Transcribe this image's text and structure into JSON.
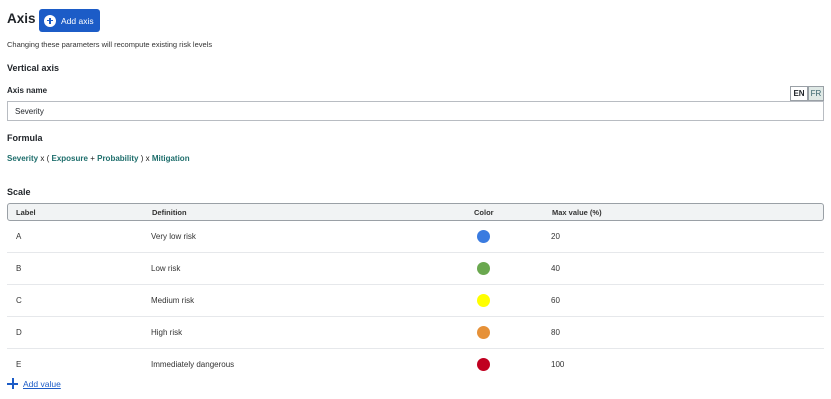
{
  "header": {
    "title": "Axis",
    "add_axis_label": "Add axis",
    "subtitle": "Changing these parameters will recompute existing risk levels"
  },
  "vertical_axis": {
    "title": "Vertical axis",
    "axis_name_label": "Axis name",
    "axis_name_value": "Severity",
    "languages": [
      "EN",
      "FR"
    ],
    "selected_language": "EN"
  },
  "formula": {
    "title": "Formula",
    "parts": [
      {
        "text": "Severity",
        "kind": "term"
      },
      {
        "text": "x (",
        "kind": "op"
      },
      {
        "text": "Exposure",
        "kind": "term"
      },
      {
        "text": "+",
        "kind": "op"
      },
      {
        "text": "Probability",
        "kind": "term"
      },
      {
        "text": ") x",
        "kind": "op"
      },
      {
        "text": "Mitigation",
        "kind": "term"
      }
    ]
  },
  "scale": {
    "title": "Scale",
    "columns": [
      "Label",
      "Definition",
      "Color",
      "Max value (%)"
    ],
    "rows": [
      {
        "label": "A",
        "definition": "Very low risk",
        "color": "#3a7be0",
        "max_value": "20"
      },
      {
        "label": "B",
        "definition": "Low risk",
        "color": "#6aa84f",
        "max_value": "40"
      },
      {
        "label": "C",
        "definition": "Medium risk",
        "color": "#ffff00",
        "max_value": "60"
      },
      {
        "label": "D",
        "definition": "High risk",
        "color": "#e69138",
        "max_value": "80"
      },
      {
        "label": "E",
        "definition": "Immediately dangerous",
        "color": "#c00020",
        "max_value": "100"
      }
    ],
    "add_value_label": "Add value"
  }
}
